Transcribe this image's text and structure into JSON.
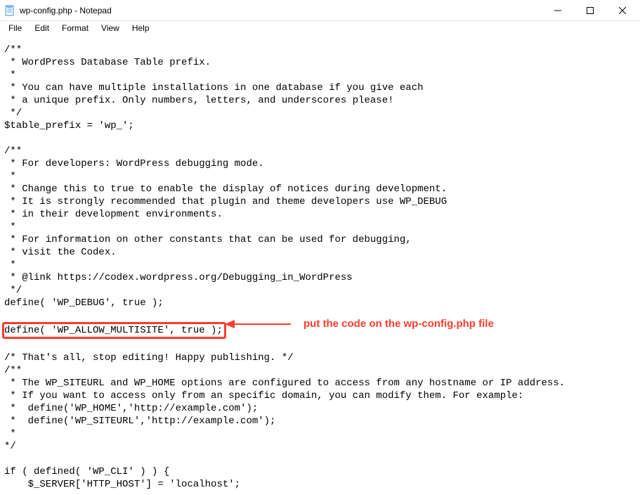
{
  "title": "wp-config.php - Notepad",
  "menu": {
    "file": "File",
    "edit": "Edit",
    "format": "Format",
    "view": "View",
    "help": "Help"
  },
  "lines": {
    "l0": "/**",
    "l1": " * WordPress Database Table prefix.",
    "l2": " *",
    "l3": " * You can have multiple installations in one database if you give each",
    "l4": " * a unique prefix. Only numbers, letters, and underscores please!",
    "l5": " */",
    "l6": "$table_prefix = 'wp_';",
    "l7": "",
    "l8": "/**",
    "l9": " * For developers: WordPress debugging mode.",
    "l10": " *",
    "l11": " * Change this to true to enable the display of notices during development.",
    "l12": " * It is strongly recommended that plugin and theme developers use WP_DEBUG",
    "l13": " * in their development environments.",
    "l14": " *",
    "l15": " * For information on other constants that can be used for debugging,",
    "l16": " * visit the Codex.",
    "l17": " *",
    "l18": " * @link https://codex.wordpress.org/Debugging_in_WordPress",
    "l19": " */",
    "l20": "define( 'WP_DEBUG', true );",
    "l21": "",
    "hl": "define( 'WP_ALLOW_MULTISITE', true );",
    "l22": "",
    "l23": "/* That's all, stop editing! Happy publishing. */",
    "l24": "/**",
    "l25": " * The WP_SITEURL and WP_HOME options are configured to access from any hostname or IP address.",
    "l26": " * If you want to access only from an specific domain, you can modify them. For example:",
    "l27": " *  define('WP_HOME','http://example.com');",
    "l28": " *  define('WP_SITEURL','http://example.com');",
    "l29": " *",
    "l30": "*/",
    "l31": "",
    "l32": "if ( defined( 'WP_CLI' ) ) {",
    "l33": "    $_SERVER['HTTP_HOST'] = 'localhost';"
  },
  "annotation": "put the code on the wp-config.php file"
}
